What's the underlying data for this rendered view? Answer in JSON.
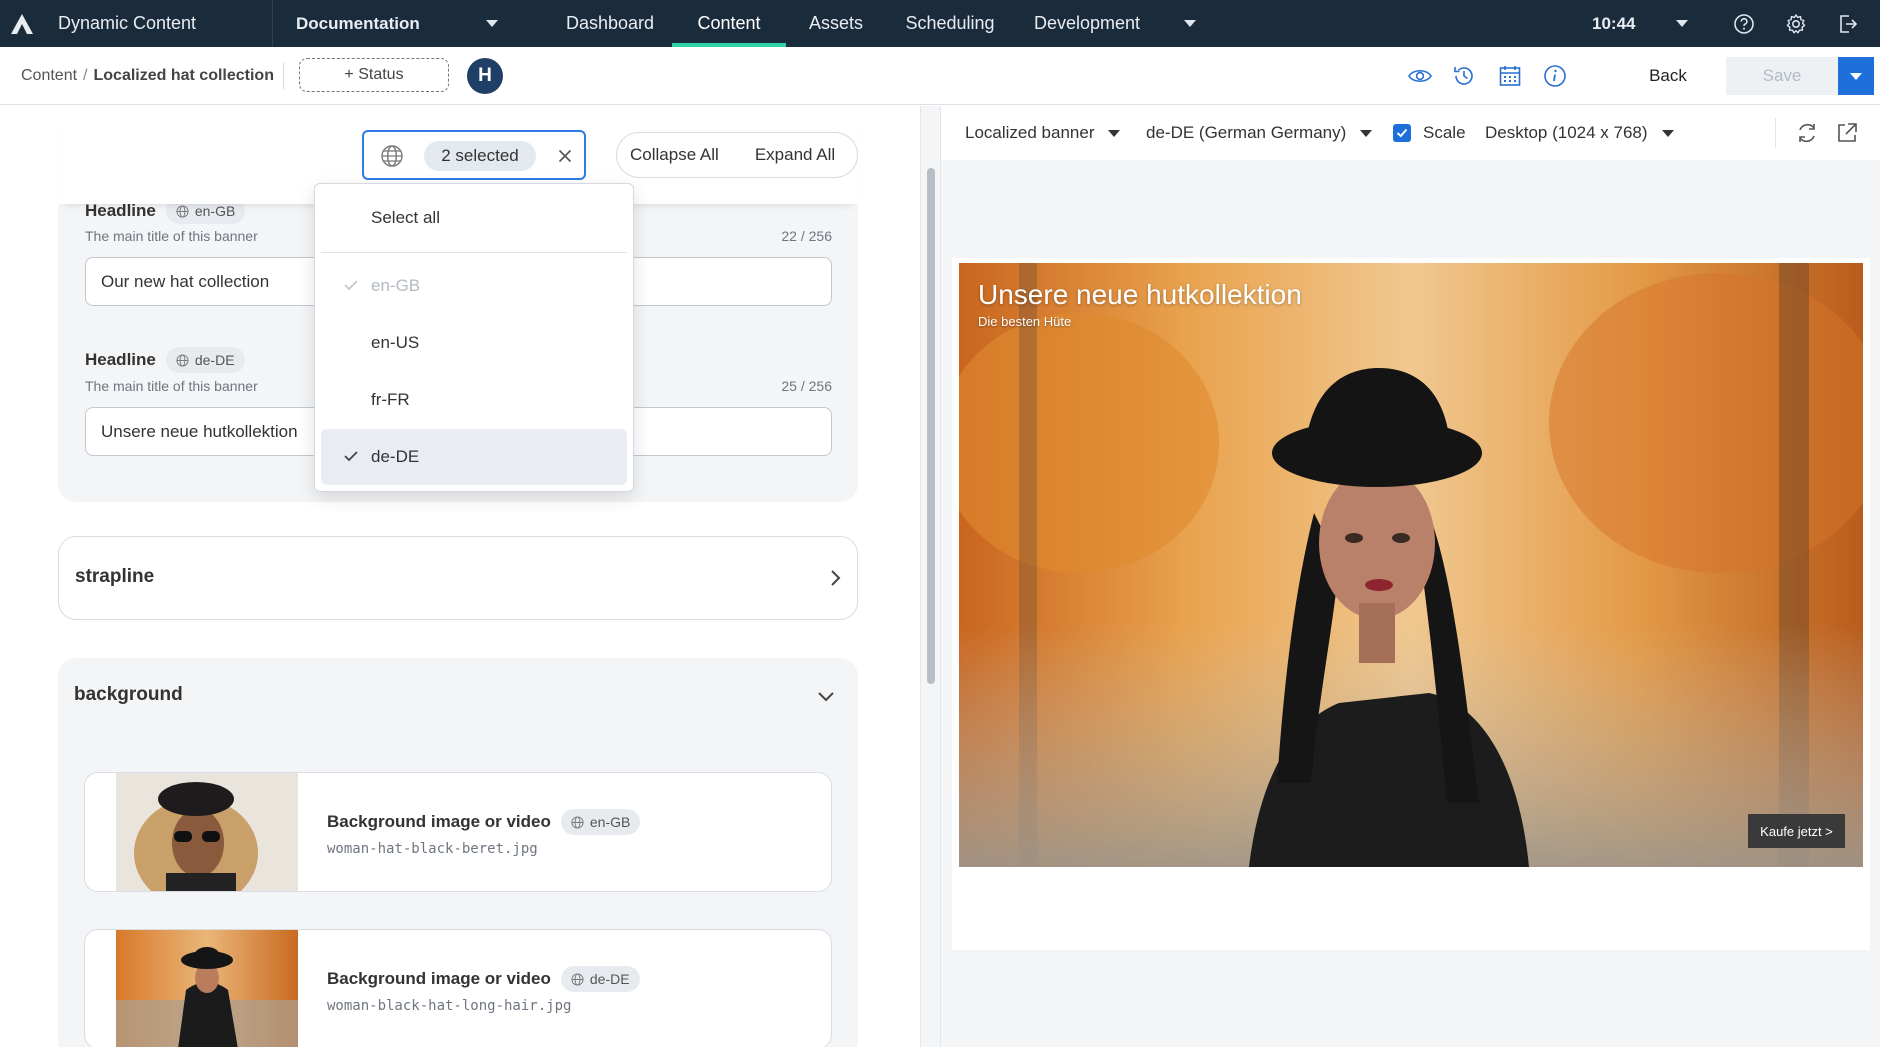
{
  "topnav": {
    "app_name": "Dynamic Content",
    "hub_name": "Documentation",
    "tabs": [
      "Dashboard",
      "Content",
      "Assets",
      "Scheduling",
      "Development"
    ],
    "active_tab": "Content",
    "time": "10:44",
    "accent_color": "#2fd1a6",
    "background_color": "#1a2b3c"
  },
  "subheader": {
    "breadcrumb_root": "Content",
    "breadcrumb_separator": "/",
    "breadcrumb_current": "Localized hat collection",
    "status_button": "+ Status",
    "avatar_initial": "H",
    "back_label": "Back",
    "save_label": "Save"
  },
  "locale_filter": {
    "chip_text": "2 selected",
    "collapse_all": "Collapse All",
    "expand_all": "Expand All",
    "options": [
      {
        "label": "Select all"
      },
      {
        "label": "en-GB",
        "checked": true,
        "disabled": true
      },
      {
        "label": "en-US"
      },
      {
        "label": "fr-FR"
      },
      {
        "label": "de-DE",
        "checked": true
      }
    ]
  },
  "fields": [
    {
      "label": "Headline",
      "locale": "en-GB",
      "description": "The main title of this banner",
      "counter": "22 / 256",
      "value": "Our new hat collection"
    },
    {
      "label": "Headline",
      "locale": "de-DE",
      "description": "The main title of this banner",
      "counter": "25 / 256",
      "value": "Unsere neue hutkollektion"
    }
  ],
  "sections": {
    "strapline": "strapline",
    "background": "background"
  },
  "media": [
    {
      "label": "Background image or video",
      "locale": "en-GB",
      "filename": "woman-hat-black-beret.jpg"
    },
    {
      "label": "Background image or video",
      "locale": "de-DE",
      "filename": "woman-black-hat-long-hair.jpg"
    }
  ],
  "preview": {
    "template": "Localized banner",
    "locale": "de-DE (German Germany)",
    "scale_label": "Scale",
    "scale_checked": true,
    "device": "Desktop (1024 x 768)",
    "banner": {
      "title": "Unsere neue hutkollektion",
      "subtitle": "Die besten Hüte",
      "cta": "Kaufe jetzt >"
    }
  },
  "icons": [
    "logo-icon",
    "help-icon",
    "gear-icon",
    "logout-icon",
    "eye-icon",
    "history-icon",
    "calendar-icon",
    "info-icon",
    "globe-icon",
    "close-icon",
    "check-icon",
    "chevron-right-icon",
    "chevron-down-icon",
    "refresh-icon",
    "external-link-icon"
  ]
}
